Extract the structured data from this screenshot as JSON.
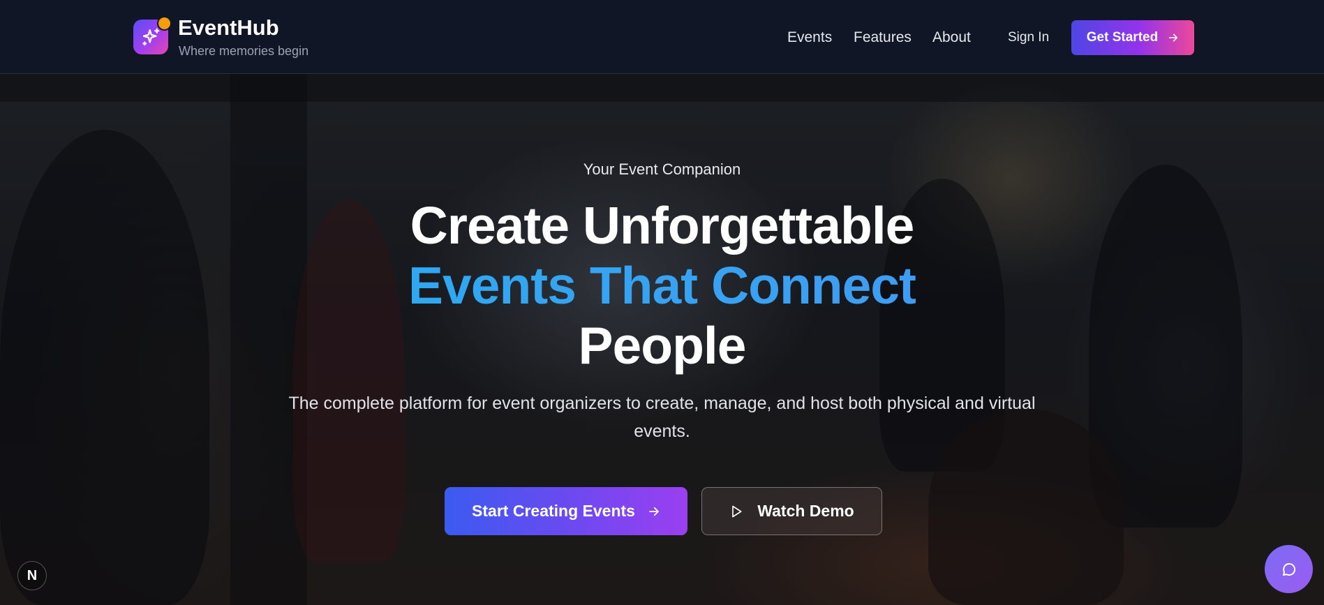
{
  "brand": {
    "name": "EventHub",
    "tagline": "Where memories begin",
    "logo_icon": "sparkles-icon",
    "accent_dot_color": "#f59e0b"
  },
  "nav": {
    "links": [
      "Events",
      "Features",
      "About"
    ],
    "sign_in": "Sign In",
    "cta": "Get Started"
  },
  "hero": {
    "eyebrow": "Your Event Companion",
    "headline_line1": "Create Unforgettable",
    "headline_line2": "Events That Connect",
    "headline_line3": "People",
    "subtitle": "The complete platform for event organizers to create, manage, and host both physical and virtual events.",
    "primary_button": "Start Creating Events",
    "secondary_button": "Watch Demo"
  },
  "overlays": {
    "framework_badge": "N",
    "chat_icon": "chat-bubble-icon"
  },
  "colors": {
    "nav_bg": "#111626",
    "headline_accent": "#2ea6f1",
    "cta_gradient": [
      "#4f46e5",
      "#9333ea",
      "#ec4899"
    ],
    "primary_gradient": [
      "#3b5bf0",
      "#9b3ff0"
    ]
  }
}
